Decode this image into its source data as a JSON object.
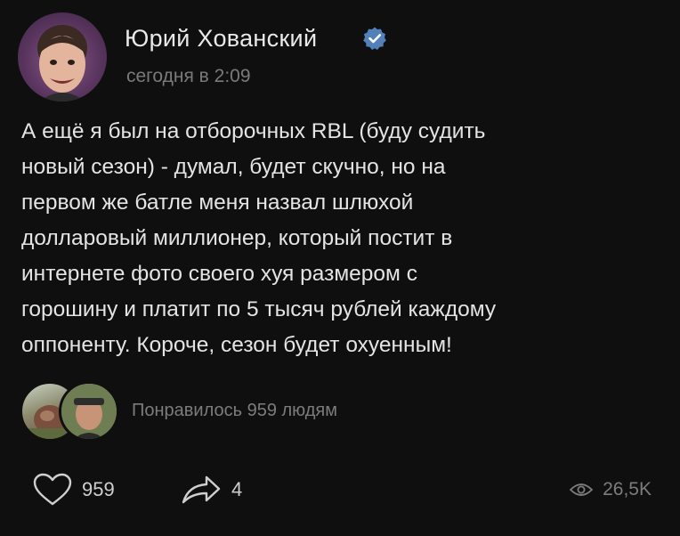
{
  "post": {
    "author": "Юрий Хованский",
    "time": "сегодня в 2:09",
    "text_lines": [
      "А ещё я был на отборочных RBL (буду судить",
      "новый сезон) - думал, будет скучно, но на",
      "первом же батле меня назвал шлюхой",
      "долларовый миллионер, который постит в",
      "интернете фото своего хуя размером с",
      "горошину и платит по 5 тысяч рублей каждому",
      "оппоненту. Короче, сезон будет охуенным!"
    ],
    "likes_summary": "Понравилось 959 людям",
    "likes_count": "959",
    "shares_count": "4",
    "views_count": "26,5K"
  },
  "colors": {
    "background": "#0f0f0f",
    "verified": "#5181b8",
    "muted": "#7c7c7c",
    "text": "#e4e4e4"
  },
  "icons": {
    "verified": "verified-badge-icon",
    "like": "heart-icon",
    "share": "share-arrow-icon",
    "views": "eye-icon"
  }
}
